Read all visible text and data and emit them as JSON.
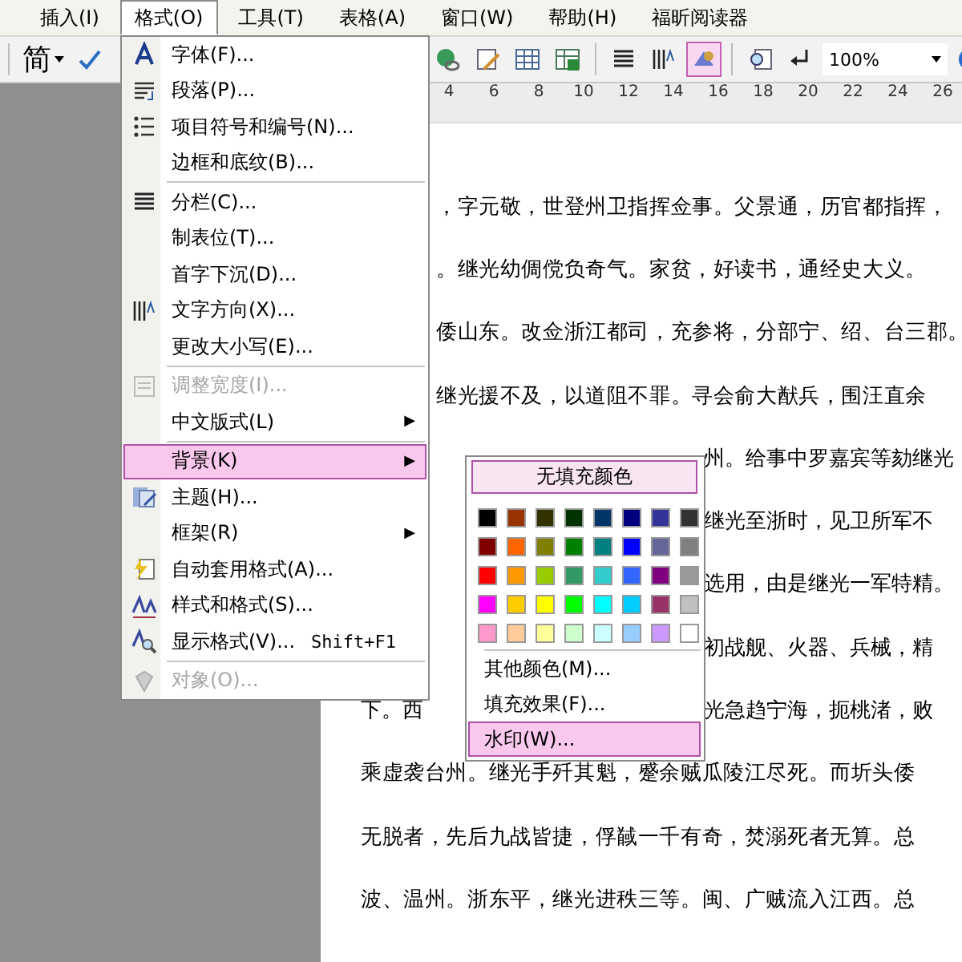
{
  "menubar": {
    "items": [
      {
        "label": "插入(I)",
        "selected": false
      },
      {
        "label": "格式(O)",
        "selected": true
      },
      {
        "label": "工具(T)",
        "selected": false
      },
      {
        "label": "表格(A)",
        "selected": false
      },
      {
        "label": "窗口(W)",
        "selected": false
      },
      {
        "label": "帮助(H)",
        "selected": false
      },
      {
        "label": "福昕阅读器",
        "selected": false
      }
    ]
  },
  "toolbar": {
    "script_label": "简",
    "buttons": [
      {
        "pressed": false
      },
      {
        "pressed": false
      },
      {
        "pressed": false
      },
      {
        "pressed": false
      },
      {
        "pressed": false
      },
      {
        "pressed": false
      },
      {
        "pressed": true
      },
      {
        "pressed": false
      },
      {
        "pressed": false
      }
    ],
    "zoom": "100%"
  },
  "ruler": {
    "labels": [
      "4",
      "6",
      "8",
      "10",
      "12",
      "14",
      "16",
      "18",
      "20",
      "22",
      "24",
      "26"
    ]
  },
  "document": {
    "lines": [
      {
        "kind": "after_menu",
        "segments": [
          "，字元敬，世登州卫指挥佥事。父景通，历官都指挥，"
        ]
      },
      {
        "kind": "after_menu",
        "segments": [
          "。继光幼倜傥负奇气。家贫，好读书，通经史大义。"
        ]
      },
      {
        "kind": "after_menu",
        "segments": [
          "倭山东。改佥浙江都司，充参将，分部宁、绍、台三郡。"
        ]
      },
      {
        "kind": "after_menu",
        "segments": [
          "继光援不及，以道阻不罪。寻会俞大猷兵，围汪直余"
        ]
      },
      {
        "kind": "after_submenu",
        "segments": [
          "州。给事中罗嘉宾等劾继光"
        ]
      },
      {
        "kind": "after_submenu",
        "segments": [
          "继光至浙时，见卫所军不"
        ]
      },
      {
        "kind": "after_submenu",
        "segments": [
          "选用，由是继光一军特精。"
        ]
      },
      {
        "kind": "after_submenu",
        "segments": [
          "初战舰、火器、兵械，精"
        ]
      },
      {
        "kind": "split",
        "segments": [
          "下。西",
          "光急趋宁海，扼桃渚，败"
        ]
      },
      {
        "kind": "full",
        "segments": [
          "乘虚袭台州。继光手歼其魁，蹙余贼瓜陵江尽死。而圻头倭"
        ]
      },
      {
        "kind": "full",
        "segments": [
          "无脱者，先后九战皆捷，俘馘一千有奇，焚溺死者无算。总"
        ]
      },
      {
        "kind": "full",
        "segments": [
          "波、温州。浙东平，继光进秩三等。闽、广贼流入江西。总"
        ]
      }
    ]
  },
  "format_menu": {
    "items": [
      {
        "kind": "item",
        "label": "字体(F)...",
        "disabled": false,
        "selected": false
      },
      {
        "kind": "item",
        "label": "段落(P)...",
        "disabled": false,
        "selected": false
      },
      {
        "kind": "item",
        "label": "项目符号和编号(N)...",
        "disabled": false,
        "selected": false
      },
      {
        "kind": "item",
        "label": "边框和底纹(B)...",
        "disabled": false,
        "selected": false
      },
      {
        "kind": "separator"
      },
      {
        "kind": "item",
        "label": "分栏(C)...",
        "disabled": false,
        "selected": false
      },
      {
        "kind": "item",
        "label": "制表位(T)...",
        "disabled": false,
        "selected": false
      },
      {
        "kind": "item",
        "label": "首字下沉(D)...",
        "disabled": false,
        "selected": false
      },
      {
        "kind": "item",
        "label": "文字方向(X)...",
        "disabled": false,
        "selected": false
      },
      {
        "kind": "item",
        "label": "更改大小写(E)...",
        "disabled": false,
        "selected": false
      },
      {
        "kind": "separator"
      },
      {
        "kind": "item",
        "label": "调整宽度(I)...",
        "disabled": true,
        "selected": false
      },
      {
        "kind": "item",
        "label": "中文版式(L)",
        "arrow": "▶",
        "disabled": false,
        "selected": false
      },
      {
        "kind": "separator"
      },
      {
        "kind": "item",
        "label": "背景(K)",
        "arrow": "▶",
        "disabled": false,
        "selected": true
      },
      {
        "kind": "item",
        "label": "主题(H)...",
        "disabled": false,
        "selected": false
      },
      {
        "kind": "item",
        "label": "框架(R)",
        "arrow": "▶",
        "disabled": false,
        "selected": false
      },
      {
        "kind": "item",
        "label": "自动套用格式(A)...",
        "disabled": false,
        "selected": false
      },
      {
        "kind": "item",
        "label": "样式和格式(S)...",
        "disabled": false,
        "selected": false
      },
      {
        "kind": "item",
        "label": "显示格式(V)...",
        "shortcut": "Shift+F1",
        "disabled": false,
        "selected": false
      },
      {
        "kind": "separator"
      },
      {
        "kind": "item",
        "label": "对象(O)...",
        "disabled": true,
        "selected": false
      }
    ]
  },
  "background_submenu": {
    "no_fill": "无填充颜色",
    "swatches": [
      {
        "color": "#000000"
      },
      {
        "color": "#993300"
      },
      {
        "color": "#333300"
      },
      {
        "color": "#003300"
      },
      {
        "color": "#003366"
      },
      {
        "color": "#000080"
      },
      {
        "color": "#333399"
      },
      {
        "color": "#333333"
      },
      {
        "color": "#800000"
      },
      {
        "color": "#ff6600"
      },
      {
        "color": "#808000"
      },
      {
        "color": "#008000"
      },
      {
        "color": "#008080"
      },
      {
        "color": "#0000ff"
      },
      {
        "color": "#666699"
      },
      {
        "color": "#808080"
      },
      {
        "color": "#ff0000"
      },
      {
        "color": "#ff9900"
      },
      {
        "color": "#99cc00"
      },
      {
        "color": "#339966"
      },
      {
        "color": "#33cccc"
      },
      {
        "color": "#3366ff"
      },
      {
        "color": "#800080"
      },
      {
        "color": "#999999"
      },
      {
        "color": "#ff00ff"
      },
      {
        "color": "#ffcc00"
      },
      {
        "color": "#ffff00"
      },
      {
        "color": "#00ff00"
      },
      {
        "color": "#00ffff"
      },
      {
        "color": "#00ccff"
      },
      {
        "color": "#993366"
      },
      {
        "color": "#c0c0c0"
      },
      {
        "color": "#ff99cc"
      },
      {
        "color": "#ffcc99"
      },
      {
        "color": "#ffff99"
      },
      {
        "color": "#ccffcc"
      },
      {
        "color": "#ccffff"
      },
      {
        "color": "#99ccff"
      },
      {
        "color": "#cc99ff"
      },
      {
        "color": "#ffffff"
      }
    ],
    "items": [
      {
        "label": "其他颜色(M)...",
        "selected": false
      },
      {
        "label": "填充效果(F)...",
        "selected": false
      },
      {
        "label": "水印(W)...",
        "selected": true
      }
    ]
  }
}
